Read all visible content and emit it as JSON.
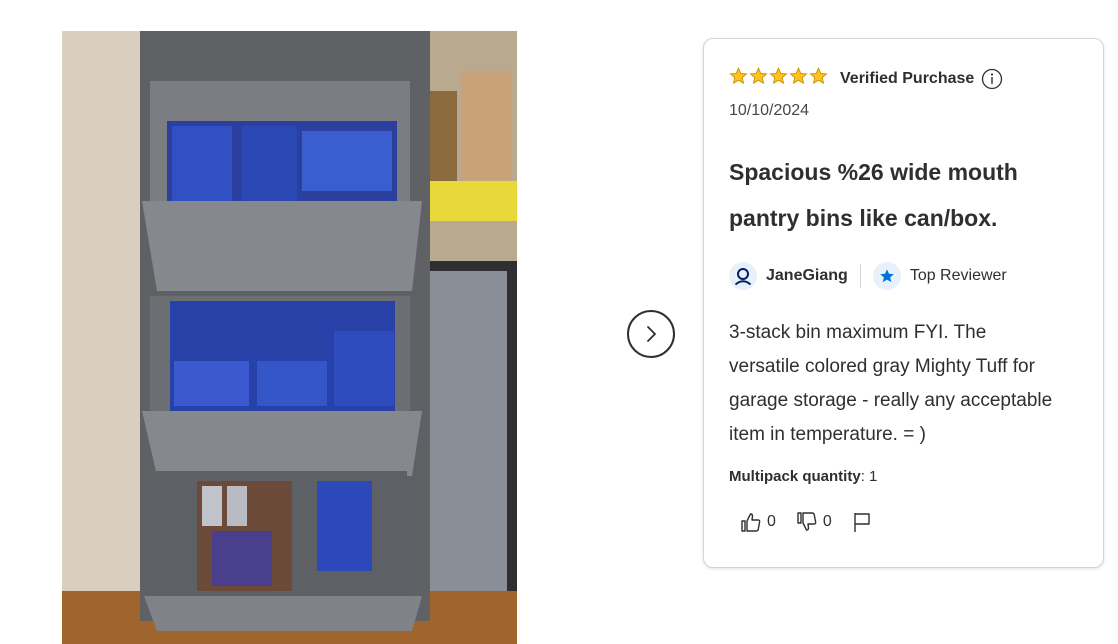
{
  "review": {
    "rating": 5,
    "verified_label": "Verified Purchase",
    "date": "10/10/2024",
    "title": "Spacious %26 wide mouth pantry bins like can/box.",
    "reviewer_name": "JaneGiang",
    "badge_label": "Top Reviewer",
    "body": "3-stack bin maximum FYI. The versatile colored gray Mighty Tuff for garage storage - really any acceptable item in temperature. = )",
    "variant_label": "Multipack quantity",
    "variant_value": ": 1",
    "helpful_count": "0",
    "unhelpful_count": "0"
  },
  "colors": {
    "star": "#ffc220",
    "star_outline": "#c99400",
    "badge_star": "#0071dc",
    "icon_bg": "#e6f1fc"
  },
  "icons": {
    "next": "chevron-right-icon",
    "info": "info-icon",
    "user": "user-icon",
    "badge": "star-icon",
    "thumbs_up": "thumbs-up-icon",
    "thumbs_down": "thumbs-down-icon",
    "flag": "flag-icon"
  },
  "photo": {
    "alt": "Stacked gray storage bins filled with pantry boxes and cans"
  }
}
